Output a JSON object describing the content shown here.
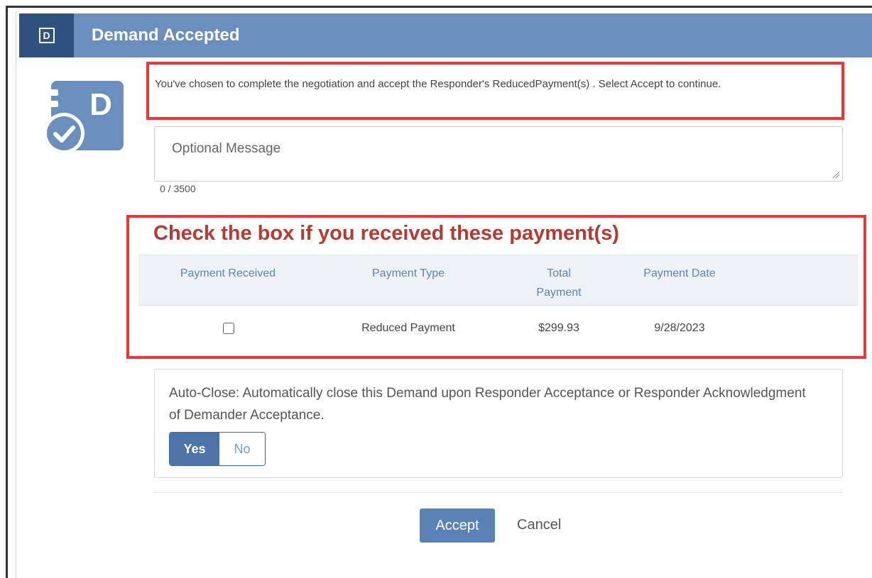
{
  "dialog": {
    "badge_letter": "D",
    "title": "Demand Accepted"
  },
  "logo": {
    "letter": "D",
    "icon": "demand-accepted-icon",
    "color": "#6b8fbd"
  },
  "notice": {
    "text": "You've chosen to complete the negotiation and accept the Responder's ReducedPayment(s) . Select Accept to continue."
  },
  "message": {
    "placeholder": "Optional Message",
    "value": "",
    "counter": "0 / 3500"
  },
  "payments": {
    "title": "Check the box if you received these payment(s)",
    "columns": {
      "received": "Payment Received",
      "type": "Payment Type",
      "total_line1": "Total",
      "total_line2": "Payment",
      "date": "Payment Date"
    },
    "rows": [
      {
        "received": false,
        "type": "Reduced Payment",
        "total": "$299.93",
        "date": "9/28/2023"
      }
    ]
  },
  "auto_close": {
    "text": "Auto-Close: Automatically close this Demand upon Responder Acceptance or Responder Acknowledgment of Demander Acceptance.",
    "yes_label": "Yes",
    "no_label": "No",
    "selected": "Yes"
  },
  "actions": {
    "accept_label": "Accept",
    "cancel_label": "Cancel"
  },
  "colors": {
    "header": "#6b8fbd",
    "header_badge": "#2e5180",
    "highlight": "#e8363b",
    "title_red": "#b43a32",
    "primary_button": "#5a82b6"
  }
}
